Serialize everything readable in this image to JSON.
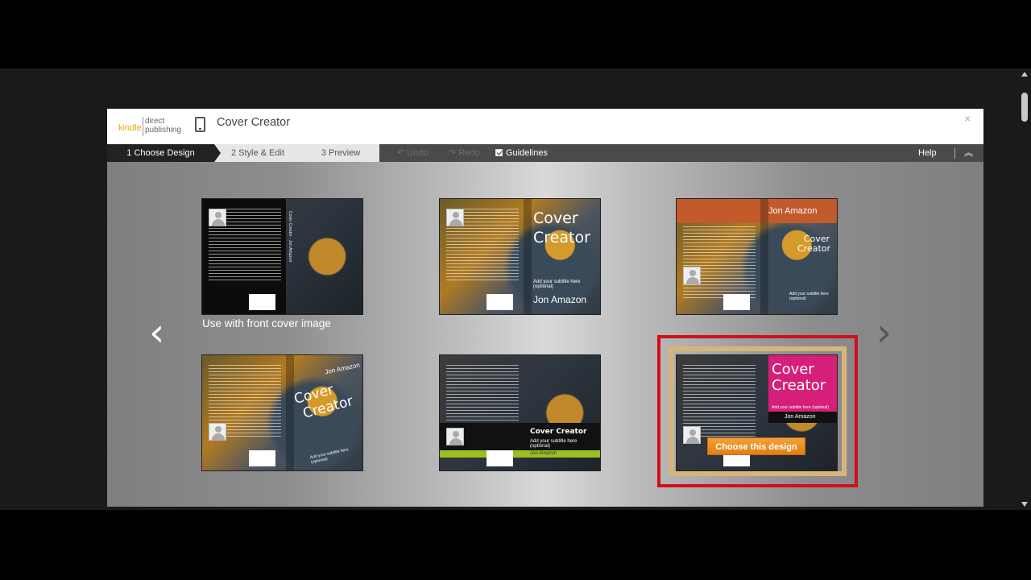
{
  "header": {
    "logo_kindle": "kindle",
    "logo_direct": "direct",
    "logo_publishing": "publishing",
    "title": "Cover Creator",
    "close": "×"
  },
  "toolbar": {
    "steps": [
      "1 Choose Design",
      "2 Style & Edit",
      "3 Preview"
    ],
    "undo": "↶ Undo",
    "redo": "↷ Redo",
    "guidelines": "Guidelines",
    "help": "Help",
    "collapse": "︽"
  },
  "designs": {
    "d1": {
      "caption": "Use with front cover image",
      "spine": "Cover Creator  ·  Jon Amazon"
    },
    "d2": {
      "title_line1": "Cover",
      "title_line2": "Creator",
      "subtitle": "Add your subtitle here (optional)",
      "author": "Jon Amazon"
    },
    "d3": {
      "author": "Jon Amazon",
      "title_line1": "Cover",
      "title_line2": "Creator",
      "subtitle": "Add your subtitle here (optional)"
    },
    "d4": {
      "author": "Jon Amazon",
      "title_line1": "Cover",
      "title_line2": "Creator",
      "subtitle": "Add your subtitle here (optional)"
    },
    "d5": {
      "title": "Cover Creator",
      "subtitle": "Add your subtitle here (optional)",
      "author": "Jon Amazon"
    },
    "d6": {
      "title_line1": "Cover",
      "title_line2": "Creator",
      "subtitle": "Add your subtitle here (optional)",
      "author": "Jon Amazon"
    }
  },
  "choose_button": "Choose this design",
  "nav": {
    "prev": "‹",
    "next": "›"
  },
  "colors": {
    "selection": "#d0101a",
    "button": "#f29a2e",
    "accent_pink": "#d61f78"
  }
}
